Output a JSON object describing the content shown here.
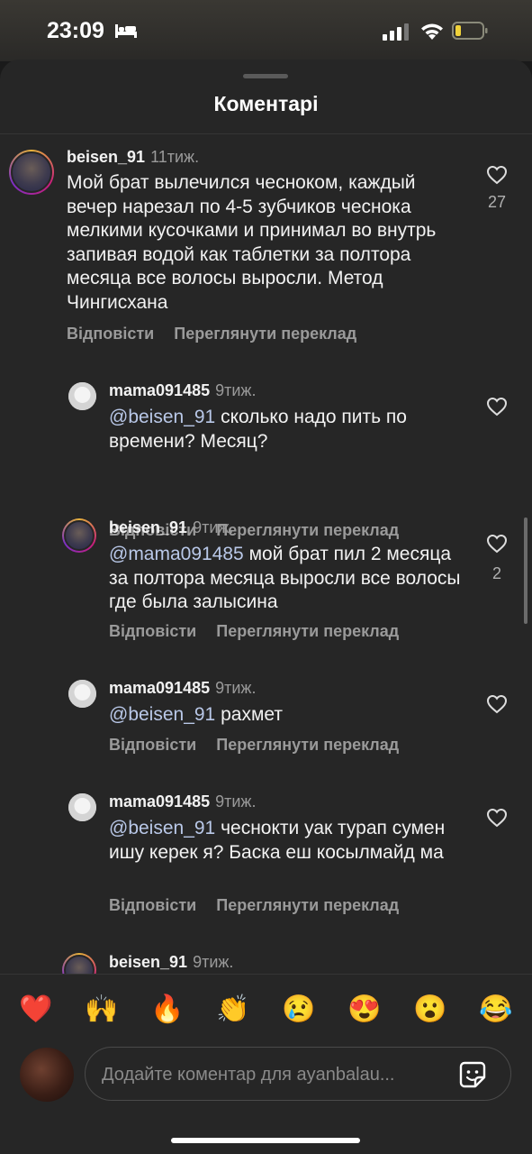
{
  "status": {
    "time": "23:09"
  },
  "sheet": {
    "title": "Коментарі"
  },
  "actions": {
    "reply": "Відповісти",
    "translate": "Переглянути переклад"
  },
  "comments": [
    {
      "username": "beisen_91",
      "age": "11тиж.",
      "text": "Мой брат вылечился чесноком, каждый вечер нарезал по 4-5 зубчиков чеснока мелкими кусочками и принимал во внутрь запивая водой как таблетки за полтора месяца все волосы выросли. Метод Чингисхана",
      "likes": "27"
    },
    {
      "username": "mama091485",
      "age": "9тиж.",
      "mention": "@beisen_91",
      "text": " сколько надо пить по времени? Месяц?",
      "likes": ""
    },
    {
      "username": "beisen_91",
      "age": "9тиж.",
      "mention": "@mama091485",
      "text": " мой брат пил 2 месяца за полтора месяца выросли все волосы где была залысина",
      "likes": "2"
    },
    {
      "username": "mama091485",
      "age": "9тиж.",
      "mention": "@beisen_91",
      "text": " рахмет",
      "likes": ""
    },
    {
      "username": "mama091485",
      "age": "9тиж.",
      "mention": "@beisen_91",
      "text": " чеснокти уак турап сумен ишу керек я? Баска еш косылмайд ма",
      "likes": ""
    },
    {
      "username": "beisen_91",
      "age": "9тиж."
    }
  ],
  "emoji_bar": [
    "❤️",
    "🙌",
    "🔥",
    "👏",
    "😢",
    "😍",
    "😮",
    "😂"
  ],
  "composer": {
    "placeholder": "Додайте коментар для ayanbalau..."
  },
  "icons": {
    "like": "heart-outline-icon",
    "sticker": "sticker-icon",
    "battery": "battery-low-icon",
    "wifi": "wifi-icon",
    "signal": "signal-bars-icon",
    "sleep": "bed-icon"
  },
  "colors": {
    "background": "#262626",
    "mention": "#b9c8e8",
    "battery_level": "#f0d23a"
  }
}
